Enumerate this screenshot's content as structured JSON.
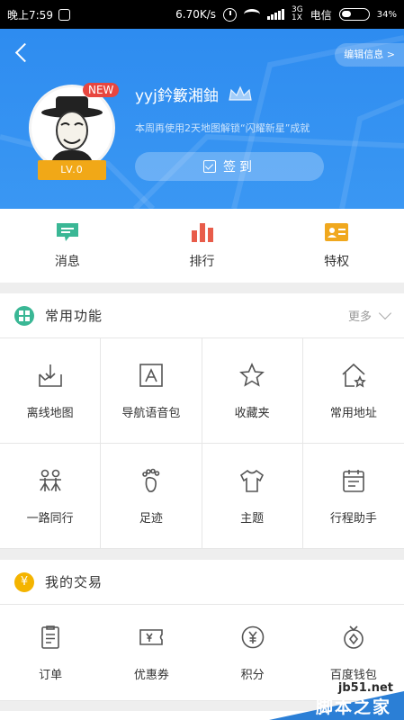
{
  "status_bar": {
    "time": "晚上7:59",
    "speed": "6.70K/s",
    "network": "3G",
    "network2": "1X",
    "carrier": "电信",
    "battery": "34%"
  },
  "header": {
    "edit_label": "编辑信息 >",
    "new_badge": "NEW",
    "level": "LV.0",
    "username": "yyj鈐籔湘鈾",
    "tip": "本周再使用2天地图解锁“闪耀新星”成就",
    "signin_label": "签到"
  },
  "quick": [
    {
      "label": "消息",
      "icon": "message-icon",
      "color": "#3ab795"
    },
    {
      "label": "排行",
      "icon": "ranking-icon",
      "color": "#e85c4a"
    },
    {
      "label": "特权",
      "icon": "privilege-icon",
      "color": "#f0a81e"
    }
  ],
  "common": {
    "title": "常用功能",
    "more": "更多",
    "items": [
      {
        "label": "离线地图",
        "icon": "offline-map-icon"
      },
      {
        "label": "导航语音包",
        "icon": "voice-package-icon"
      },
      {
        "label": "收藏夹",
        "icon": "favorites-icon"
      },
      {
        "label": "常用地址",
        "icon": "common-address-icon"
      },
      {
        "label": "一路同行",
        "icon": "travel-together-icon"
      },
      {
        "label": "足迹",
        "icon": "footprint-icon"
      },
      {
        "label": "主题",
        "icon": "theme-icon"
      },
      {
        "label": "行程助手",
        "icon": "trip-assistant-icon"
      }
    ]
  },
  "trade": {
    "title": "我的交易",
    "items": [
      {
        "label": "订单",
        "icon": "order-icon"
      },
      {
        "label": "优惠券",
        "icon": "coupon-icon"
      },
      {
        "label": "积分",
        "icon": "points-icon"
      },
      {
        "label": "百度钱包",
        "icon": "wallet-icon"
      }
    ]
  },
  "watermark": {
    "url": "jb51.net",
    "text": "脚本之家"
  },
  "colors": {
    "brand_blue": "#2e8cf0",
    "new_red": "#e8463f",
    "level_orange": "#f1a817",
    "section_green": "#3ab795",
    "trade_yellow": "#f4b400"
  }
}
